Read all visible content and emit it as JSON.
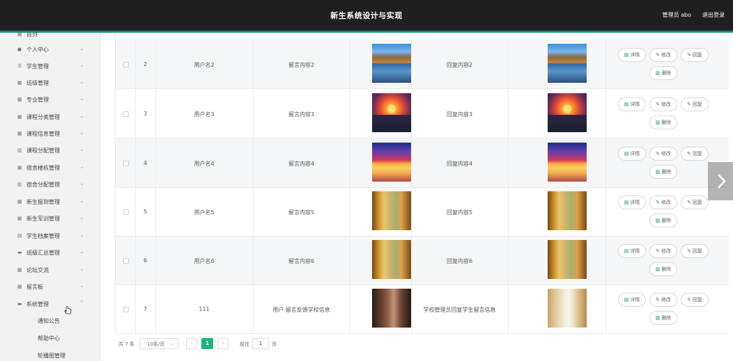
{
  "header": {
    "title": "新生系统设计与实现",
    "admin": "管理员 abo",
    "logout": "退出登录"
  },
  "sidebar": {
    "partial_top": "首页",
    "items": [
      {
        "label": "个人中心",
        "icon": "user-icon"
      },
      {
        "label": "学生管理",
        "icon": "list-icon"
      },
      {
        "label": "班级管理",
        "icon": "grid-icon"
      },
      {
        "label": "专业管理",
        "icon": "grid-icon"
      },
      {
        "label": "课程分类管理",
        "icon": "grid-icon"
      },
      {
        "label": "课程信息管理",
        "icon": "grid-icon"
      },
      {
        "label": "课程分配管理",
        "icon": "chart-icon"
      },
      {
        "label": "宿舍楼栋管理",
        "icon": "grid-icon"
      },
      {
        "label": "宿舍分配管理",
        "icon": "chart-icon"
      },
      {
        "label": "新生报到管理",
        "icon": "grid-icon"
      },
      {
        "label": "新生军训管理",
        "icon": "grid-icon"
      },
      {
        "label": "学生档案管理",
        "icon": "doc-icon"
      },
      {
        "label": "班级汇总管理",
        "icon": "chat-icon"
      },
      {
        "label": "论坛交流",
        "icon": "grid-icon"
      },
      {
        "label": "留言板",
        "icon": "grid-icon"
      },
      {
        "label": "系统管理",
        "icon": "chat-icon"
      }
    ],
    "sub_items": [
      "通知公告",
      "帮助中心",
      "轮播图管理"
    ]
  },
  "table": {
    "rows": [
      {
        "index": "2",
        "username": "用户名2",
        "message": "留言内容2",
        "reply": "回复内容2",
        "image": "lake"
      },
      {
        "index": "3",
        "username": "用户名3",
        "message": "留言内容3",
        "reply": "回复内容3",
        "image": "sunset"
      },
      {
        "index": "4",
        "username": "用户名4",
        "message": "留言内容4",
        "reply": "回复内容4",
        "image": "dolphin"
      },
      {
        "index": "5",
        "username": "用户名5",
        "message": "留言内容5",
        "reply": "回复内容5",
        "image": "forest"
      },
      {
        "index": "6",
        "username": "用户名6",
        "message": "留言内容6",
        "reply": "回复内容6",
        "image": "forest"
      },
      {
        "index": "7",
        "username": "111",
        "message": "用户 留言反馈学校信息",
        "reply": "学校管理员回复学生留言信息",
        "image": "library"
      }
    ],
    "actions": {
      "detail": "详情",
      "edit": "修改",
      "reply": "回复",
      "delete": "删除"
    }
  },
  "pagination": {
    "total": "共 7 条",
    "page_size": "10条/页",
    "current_page": "1",
    "goto_label": "前往",
    "goto_value": "1",
    "page_suffix": "页"
  },
  "colors": {
    "accent": "#1a8c7c",
    "primary_button": "#1fb37a",
    "topbar": "#1f1f1f"
  }
}
